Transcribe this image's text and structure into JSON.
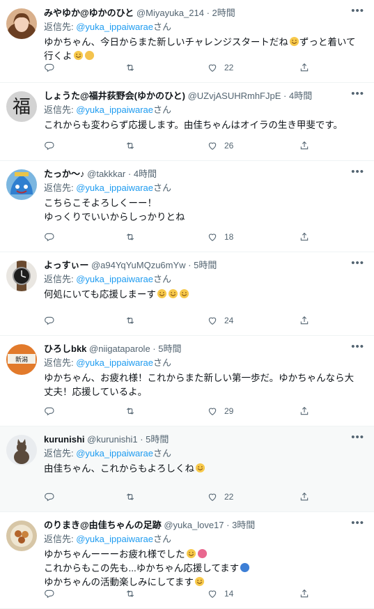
{
  "reply_prefix": "返信先: ",
  "reply_suffix": "さん",
  "tweets": [
    {
      "name": "みやゆか@ゆかのひと",
      "handle": "@Miyayuka_214",
      "time": "2時間",
      "reply_to": "@yuka_ippaiwarae",
      "lines": [
        "ゆかちゃん、今日からまた新しいチャレンジスタートだね😊ずっと着いて",
        "行くよ🥰👍"
      ],
      "likes": "22",
      "avatar": "woman-photo-avatar"
    },
    {
      "name": "しょうた@福井荻野会(ゆかのひと)",
      "handle": "@UZvjASUHRmhFJpE",
      "time": "4時間",
      "reply_to": "@yuka_ippaiwarae",
      "lines": [
        "これからも変わらず応援します。由佳ちゃんはオイラの生き甲斐です。"
      ],
      "likes": "26",
      "avatar": "fuku-kanji-avatar",
      "avatar_text": "福"
    },
    {
      "name": "たっか〜♪",
      "handle": "@takkkar",
      "time": "4時間",
      "reply_to": "@yuka_ippaiwarae",
      "lines": [
        "こちらこそよろしくーー！",
        "ゆっくりでいいからしっかりとね"
      ],
      "likes": "18",
      "avatar": "slime-avatar"
    },
    {
      "name": "よっすぃー",
      "handle": "@a94YqYuMQzu6mYw",
      "time": "5時間",
      "reply_to": "@yuka_ippaiwarae",
      "lines": [
        "何処にいても応援しまーす😄😄😄"
      ],
      "likes": "24",
      "avatar": "watch-avatar"
    },
    {
      "name": "ひろしbkk",
      "handle": "@niigataparole",
      "time": "5時間",
      "reply_to": "@yuka_ippaiwarae",
      "lines": [
        "ゆかちゃん、お疲れ様！これからまた新しい第一歩だ。ゆかちゃんなら大",
        "丈夫！応援しているよ。"
      ],
      "likes": "29",
      "avatar": "sign-avatar",
      "avatar_text": "新潟"
    },
    {
      "name": "kurunishi",
      "handle": "@kurunishi1",
      "time": "5時間",
      "reply_to": "@yuka_ippaiwarae",
      "lines": [
        "由佳ちゃん、これからもよろしくね😄"
      ],
      "likes": "22",
      "avatar": "cat-avatar"
    },
    {
      "name": "のりまき@由佳ちゃんの足跡",
      "handle": "@yuka_love17",
      "time": "3時間",
      "reply_to": "@yuka_ippaiwarae",
      "lines": [
        "ゆかちゃんーーーお疲れ様でした😊💐",
        "これからもこの先も...ゆかちゃん応援してます📣",
        "ゆかちゃんの活動楽しみにしてます🤗"
      ],
      "likes": "14",
      "avatar": "food-avatar"
    }
  ]
}
